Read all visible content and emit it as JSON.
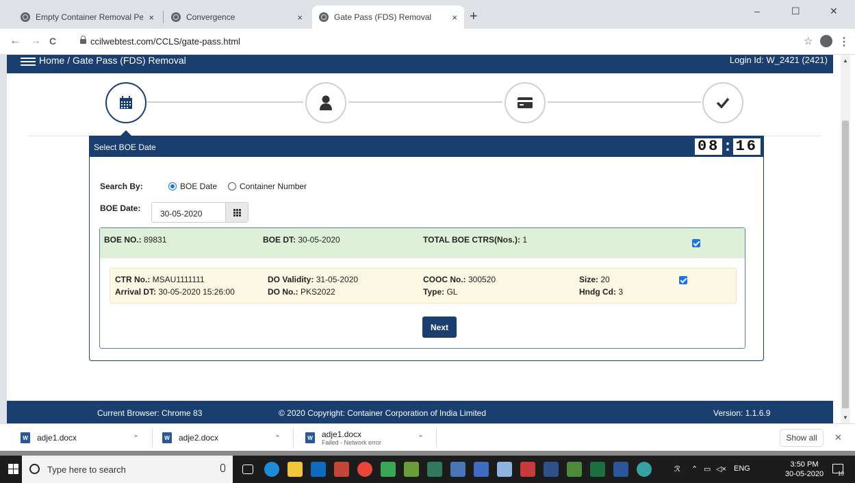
{
  "browser": {
    "tabs": [
      {
        "title": "Empty Container Removal Permit",
        "close": "×"
      },
      {
        "title": "Convergence",
        "close": "×"
      },
      {
        "title": "Gate Pass (FDS) Removal",
        "close": "×"
      }
    ],
    "new_tab": "+",
    "window_controls": {
      "minimize": "–",
      "maximize": "☐",
      "close": "✕"
    },
    "nav": {
      "back": "←",
      "forward": "→",
      "reload": "C"
    },
    "url": "ccilwebtest.com/CCLS/gate-pass.html",
    "star": "☆",
    "menu": "⋮"
  },
  "app": {
    "breadcrumb": "Home / Gate Pass (FDS) Removal",
    "login_id": "Login Id: W_2421 (2421)",
    "steps": [
      {
        "icon": "calendar-icon",
        "active": true
      },
      {
        "icon": "user-icon",
        "active": false
      },
      {
        "icon": "card-icon",
        "active": false
      },
      {
        "icon": "check-icon",
        "active": false
      }
    ],
    "panel": {
      "title": "Select BOE Date",
      "timer": {
        "minutes": "08",
        "seconds": "16",
        "separator": ":"
      },
      "search_by_label": "Search By:",
      "search_options": [
        "BOE Date",
        "Container Number"
      ],
      "selected_option": "BOE Date",
      "boe_date_label": "BOE Date:",
      "boe_date_value": "30-05-2020"
    },
    "boe": {
      "no_label": "BOE NO.:",
      "no_value": " 89831",
      "dt_label": "BOE DT:",
      "dt_value": " 30-05-2020",
      "total_label": "TOTAL BOE CTRS(Nos.):",
      "total_value": " 1",
      "checked": true
    },
    "container": {
      "ctr_label": "CTR No.:",
      "ctr_value": " MSAU1111111",
      "arrival_label": "Arrival DT:",
      "arrival_value": " 30-05-2020 15:26:00",
      "do_validity_label": "DO Validity:",
      "do_validity_value": " 31-05-2020",
      "do_no_label": "DO No.:",
      "do_no_value": " PKS2022",
      "cooc_label": "COOC No.:",
      "cooc_value": " 300520",
      "type_label": "Type:",
      "type_value": " GL",
      "size_label": "Size:",
      "size_value": " 20",
      "hndg_label": "Hndg Cd:",
      "hndg_value": " 3",
      "checked": true
    },
    "next_button": "Next",
    "footer": {
      "browser": "Current Browser: Chrome 83",
      "copyright": "© 2020 Copyright: Container Corporation of India Limited",
      "version": "Version: 1.1.6.9"
    }
  },
  "downloads": {
    "items": [
      {
        "name": "adje1.docx",
        "status": ""
      },
      {
        "name": "adje2.docx",
        "status": ""
      },
      {
        "name": "adje1.docx",
        "status": "Failed - Network error"
      }
    ],
    "show_all": "Show all",
    "close": "✕"
  },
  "taskbar": {
    "search_placeholder": "Type here to search",
    "tray": {
      "lang": "ENG",
      "time": "3:50 PM",
      "date": "30-05-2020",
      "notifications": "10"
    }
  },
  "colors": {
    "primary": "#1a3e6e",
    "boe_bg": "#dff0d8",
    "ctr_bg": "#fcf8e3",
    "checkbox": "#1a73e8"
  }
}
